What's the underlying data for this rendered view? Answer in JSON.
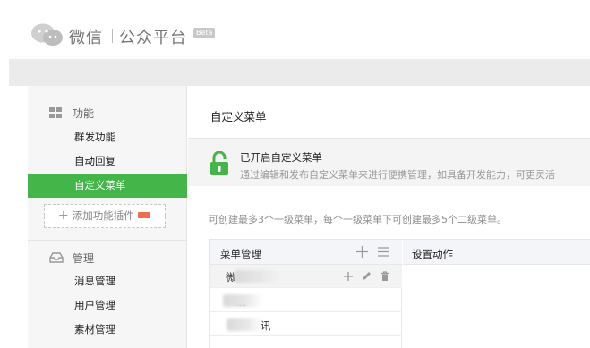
{
  "header": {
    "brand_name": "微信",
    "brand_sub": "公众平台",
    "beta": "Beta"
  },
  "sidebar": {
    "sections": [
      {
        "title": "功能",
        "icon": "grid-icon",
        "items": [
          "群发功能",
          "自动回复",
          "自定义菜单"
        ]
      },
      {
        "title": "管理",
        "icon": "tray-icon",
        "items": [
          "消息管理",
          "用户管理",
          "素材管理"
        ]
      }
    ],
    "active_item": "自定义菜单",
    "add_plugin_label": "添加功能插件"
  },
  "main": {
    "title": "自定义菜单",
    "notice": {
      "title": "已开启自定义菜单",
      "description": "通过编辑和发布自定义菜单来进行便携管理，如具备开发能力，可更灵活"
    },
    "limits_text": "可创建最多3个一级菜单，每个一级菜单下可创建最多5个二级菜单。",
    "menu_table": {
      "left_header": "菜单管理",
      "right_header": "设置动作",
      "rows": [
        {
          "label": "微"
        },
        {
          "label": "后"
        },
        {
          "label": "讯"
        }
      ]
    }
  },
  "colors": {
    "accent_green": "#44b549",
    "lock_green": "#44b549",
    "new_tag": "#f26d50"
  }
}
